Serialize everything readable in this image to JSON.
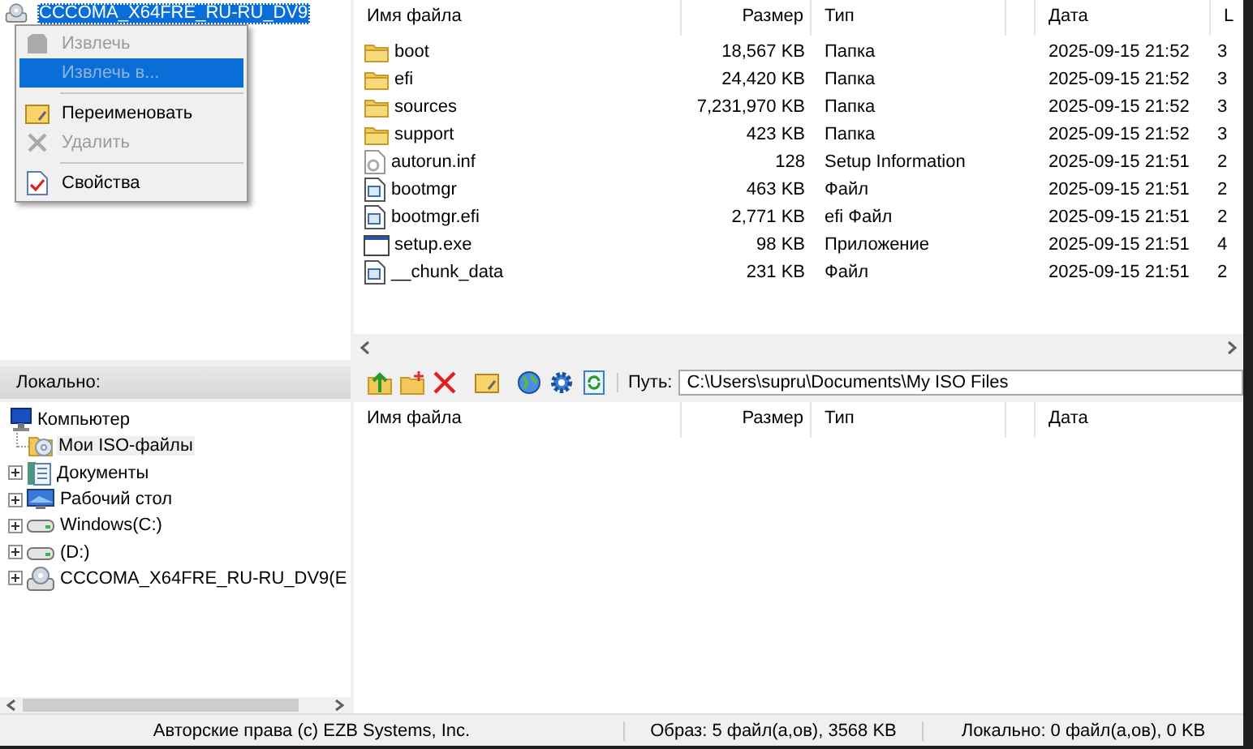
{
  "image_tree": {
    "root": {
      "label": "CCCOMA_X64FRE_RU-RU_DV9",
      "selected": true
    }
  },
  "context_menu": {
    "items": [
      {
        "kind": "item",
        "label": "Извлечь",
        "disabled": true,
        "selected": false
      },
      {
        "kind": "item",
        "label": "Извлечь в...",
        "disabled": true,
        "selected": true
      },
      {
        "kind": "separator"
      },
      {
        "kind": "item",
        "label": "Переименовать",
        "disabled": false,
        "selected": false
      },
      {
        "kind": "item",
        "label": "Удалить",
        "disabled": true,
        "selected": false
      },
      {
        "kind": "separator"
      },
      {
        "kind": "item",
        "label": "Свойства",
        "disabled": false,
        "selected": false
      }
    ]
  },
  "image_files": {
    "columns": [
      "Имя файла",
      "Размер",
      "Тип",
      "Дата",
      "L"
    ],
    "rows": [
      {
        "kind": "folder",
        "name": "boot",
        "size": "18,567 KB",
        "type": "Папка",
        "date": "2025-09-15 21:52",
        "column_5": "3"
      },
      {
        "kind": "folder",
        "name": "efi",
        "size": "24,420 KB",
        "type": "Папка",
        "date": "2025-09-15 21:52",
        "column_5": "3"
      },
      {
        "kind": "folder",
        "name": "sources",
        "size": "7,231,970 KB",
        "type": "Папка",
        "date": "2025-09-15 21:52",
        "column_5": "3"
      },
      {
        "kind": "folder",
        "name": "support",
        "size": "423 KB",
        "type": "Папка",
        "date": "2025-09-15 21:52",
        "column_5": "3"
      },
      {
        "kind": "settings",
        "name": "autorun.inf",
        "size": "128",
        "type": "Setup Information",
        "date": "2025-09-15 21:51",
        "column_5": "2"
      },
      {
        "kind": "system",
        "name": "bootmgr",
        "size": "463 KB",
        "type": "Файл",
        "date": "2025-09-15 21:51",
        "column_5": "2"
      },
      {
        "kind": "system",
        "name": "bootmgr.efi",
        "size": "2,771 KB",
        "type": "efi Файл",
        "date": "2025-09-15 21:51",
        "column_5": "2"
      },
      {
        "kind": "app",
        "name": "setup.exe",
        "size": "98 KB",
        "type": "Приложение",
        "date": "2025-09-15 21:51",
        "column_5": "4"
      },
      {
        "kind": "system",
        "name": "__chunk_data",
        "size": "231 KB",
        "type": "Файл",
        "date": "2025-09-15 21:51",
        "column_5": "2"
      }
    ]
  },
  "local_bar": {
    "label": "Локально:",
    "path_label": "Путь:",
    "path": "C:\\Users\\supru\\Documents\\My ISO Files"
  },
  "local_tree": {
    "root": {
      "kind": "computer",
      "label": "Компьютер",
      "children": [
        {
          "kind": "iso",
          "label": "Мои ISO-файлы",
          "expandable": false,
          "selected": true
        },
        {
          "kind": "documents",
          "label": "Документы",
          "expandable": true,
          "selected": false
        },
        {
          "kind": "desktop",
          "label": "Рабочий стол",
          "expandable": true,
          "selected": false
        },
        {
          "kind": "drive",
          "label": "Windows(C:)",
          "expandable": true,
          "selected": false
        },
        {
          "kind": "drive",
          "label": "(D:)",
          "expandable": true,
          "selected": false
        },
        {
          "kind": "cd",
          "label": "CCCOMA_X64FRE_RU-RU_DV9(E",
          "expandable": true,
          "selected": false
        }
      ]
    }
  },
  "local_files": {
    "columns": [
      "Имя файла",
      "Размер",
      "Тип",
      "Дата"
    ]
  },
  "status_bar": {
    "copyright": "Авторские права (c) EZB Systems, Inc.",
    "image": "Образ: 5 файл(а,ов), 3568 KB",
    "local": "Локально: 0 файл(а,ов), 0 KB"
  }
}
